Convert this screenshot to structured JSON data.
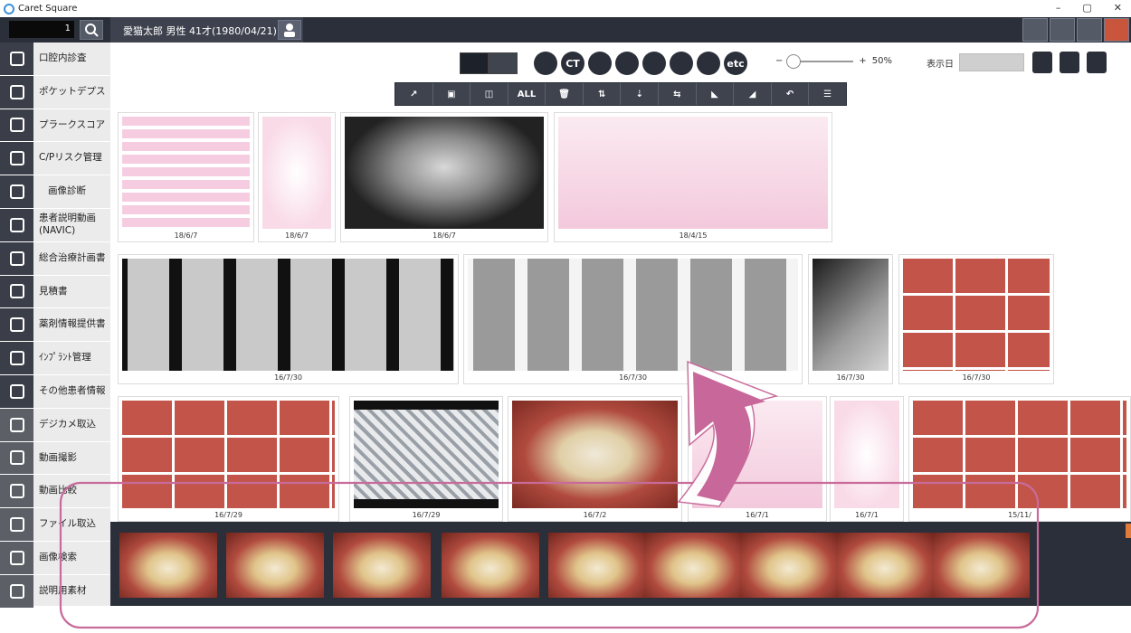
{
  "app": {
    "title": "Caret Square"
  },
  "window_controls": {
    "minimize": "–",
    "maximize": "▢",
    "close": "✕"
  },
  "topbar": {
    "patient_id": "1",
    "patient_info": "愛猫太郎 男性 41才(1980/04/21)"
  },
  "sidebar": {
    "items": [
      {
        "label": "口腔内診査",
        "icon": "circle-minus-icon"
      },
      {
        "label": "ポケットデプス",
        "icon": "tooth-icon"
      },
      {
        "label": "プラークスコア",
        "icon": "grid-x-icon"
      },
      {
        "label": "C/Pリスク管理",
        "icon": "asterisk-icon"
      },
      {
        "label": "画像診断",
        "icon": "image-diagnosis-icon"
      },
      {
        "label": "患者説明動画\n(NAVIC)",
        "icon": "sparkle-icon"
      },
      {
        "label": "総合治療計画書",
        "icon": "document-edit-icon"
      },
      {
        "label": "見積書",
        "icon": "calculator-icon"
      },
      {
        "label": "薬剤情報提供書",
        "icon": "pill-icon"
      },
      {
        "label": "ｲﾝﾌﾟﾗﾝﾄ管理",
        "icon": "implant-icon"
      },
      {
        "label": "その他患者情報",
        "icon": "file-icon"
      },
      {
        "label": "デジカメ取込",
        "icon": "camera-import-icon"
      },
      {
        "label": "動画撮影",
        "icon": "video-camera-icon"
      },
      {
        "label": "動画比較",
        "icon": "video-compare-icon"
      },
      {
        "label": "ファイル取込",
        "icon": "folder-icon"
      },
      {
        "label": "画像検索",
        "icon": "image-search-icon"
      },
      {
        "label": "説明用素材",
        "icon": "material-icon"
      }
    ]
  },
  "view_buttons": {
    "round": [
      "",
      "CT",
      "",
      "",
      "",
      "",
      "",
      "etc"
    ]
  },
  "zoom": {
    "minus": "−",
    "plus": "+",
    "level": "50%",
    "value_fraction": 0.0
  },
  "date_filter": {
    "label": "表示日"
  },
  "toolbar": {
    "all_label": "ALL"
  },
  "thumbnails": {
    "dates": [
      "18/6/7",
      "18/6/7",
      "18/6/7",
      "18/4/15",
      "16/7/30",
      "16/7/30",
      "16/7/30",
      "16/7/30",
      "16/7/29",
      "16/7/29",
      "16/7/2",
      "16/7/1",
      "16/7/1",
      "15/11/"
    ]
  },
  "colors": {
    "accent": "#c86b9a",
    "dark": "#2b2f3a",
    "sidebar_icon_bg": "#3a3e48"
  }
}
